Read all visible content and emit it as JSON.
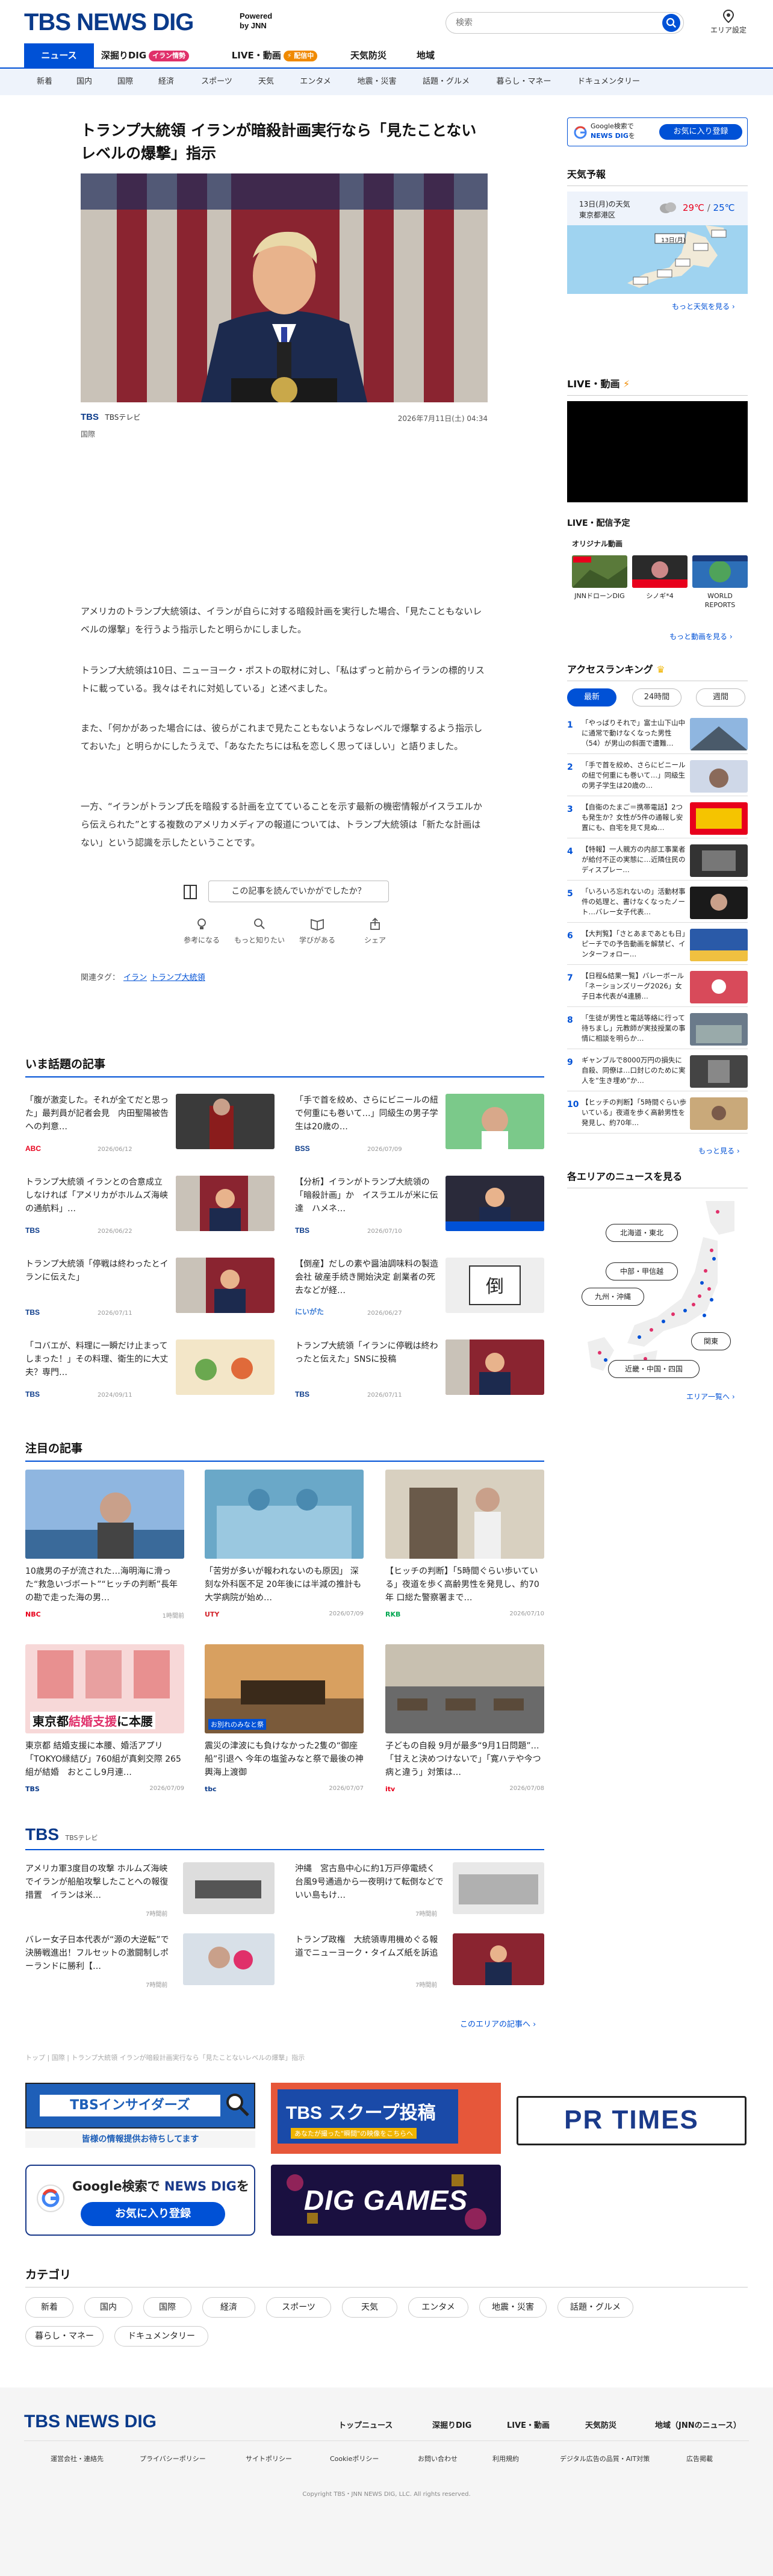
{
  "header": {
    "logo_text": "TBS NEWS DIG",
    "powered_line1": "Powered",
    "powered_line2": "by JNN",
    "search_placeholder": "検索",
    "area_label": "エリア設定",
    "nav": [
      {
        "label": "ニュース",
        "active": true
      },
      {
        "label": "深掘りDIG",
        "badge": "イラン情勢",
        "badge_color": "#e0306a"
      },
      {
        "label": "LIVE・動画",
        "badge": "⚡ 配信中",
        "badge_color": "#f08a00"
      },
      {
        "label": "天気防災"
      },
      {
        "label": "地域"
      }
    ],
    "subnav": [
      "新着",
      "国内",
      "国際",
      "経済",
      "スポーツ",
      "天気",
      "エンタメ",
      "地震・災害",
      "話題・グルメ",
      "暮らし・マネー",
      "ドキュメンタリー"
    ]
  },
  "article": {
    "title": "トランプ大統領 イランが暗殺計画実行なら「見たことないレベルの爆撃」指示",
    "source_logo": "TBS",
    "source_name": "TBSテレビ",
    "datetime": "2026年7月11日(土) 04:34",
    "category": "国際",
    "paragraphs": [
      "アメリカのトランプ大統領は、イランが自らに対する暗殺計画を実行した場合、「見たこともないレベルの爆撃」を行うよう指示したと明らかにしました。",
      "トランプ大統領は10日、ニューヨーク・ポストの取材に対し、「私はずっと前からイランの標的リストに載っている。我々はそれに対処している」と述べました。",
      "また、「何かがあった場合には、彼らがこれまで見たこともないようなレベルで爆撃するよう指示しておいた」と明らかにしたうえで、「あなたたちには私を恋しく思ってほしい」と語りました。",
      "一方、“イランがトランプ氏を暗殺する計画を立てていることを示す最新の機密情報がイスラエルから伝えられた”とする複数のアメリカメディアの報道については、トランプ大統領は「新たな計画はない」という認識を示したということです。"
    ],
    "feedback_button": "この記事を読んでいかがでしたか？",
    "reactions": [
      "参考になる",
      "もっと知りたい",
      "学びがある",
      "シェア"
    ],
    "tags_label": "関連タグ：",
    "tags": [
      "イラン",
      "トランプ大統領"
    ]
  },
  "sidebar": {
    "gsearch_line1": "Google検索で",
    "gsearch_line2": "NEWS DIG",
    "gsearch_line3": "を",
    "gsearch_button": "お気に入り登録",
    "weather_title": "天気予報",
    "weather_date": "13日(月)の天気",
    "weather_city": "東京都港区",
    "weather_high": "29℃",
    "weather_low": "25℃",
    "weather_map_date": "13日(月)",
    "weather_more": "もっと天気を見る",
    "live_title": "LIVE・動画",
    "live_schedule": "LIVE・配信予定",
    "original_video": "オリジナル動画",
    "live_items": [
      "JNNドローンDIG",
      "シノギ*4",
      "WORLD REPORTS"
    ],
    "live_more": "もっと動画を見る",
    "ranking_title": "アクセスランキング",
    "ranking_tabs": [
      "最新",
      "24時間",
      "週間"
    ],
    "ranking": [
      {
        "num": "1",
        "text": "「やっばりそれで」富士山下山中に通常で動けなくなった男性（54）が男山の斜面で遭難…"
      },
      {
        "num": "2",
        "text": "「手で首を絞め、さらにビニールの紐で何重にも巻いて…」同級生の男子学生は20歳の…"
      },
      {
        "num": "3",
        "text": "【自衛のたまご＝携帯電話】2つも発生か？女性が5件の通報し安置にも、自宅を見て見ぬ…"
      },
      {
        "num": "4",
        "text": "【特報】一人親方の内部工事業者が給付不正の実態に…近隣住民のディスプレー…"
      },
      {
        "num": "5",
        "text": "「いろいろ忘れないの」活動材事件の処理と、書けなくなったノート…バレー女子代表…"
      },
      {
        "num": "6",
        "text": "【大判覧】「さとあまであとも日」ピーチでの予告動画を解禁ビ、インターフォロー…"
      },
      {
        "num": "7",
        "text": "【日程&結果一覧】バレーボール「ネーションズリーグ2026」女子日本代表が4連勝…"
      },
      {
        "num": "8",
        "text": "「生徒が男性と電話等絡に行って待ちまし」元教師が実技授業の事情に相談を明らか…"
      },
      {
        "num": "9",
        "text": "ギャンブルで8000万円の損失に自殺、同僚は…口封じのために実人を“生き埋め”か…"
      },
      {
        "num": "10",
        "text": "【ヒッチの判断】「5時間ぐらい歩いている」夜道を歩く高齢男性を発見し、約70年…"
      }
    ],
    "ranking_more": "もっと見る",
    "area_title": "各エリアのニュースを見る",
    "areas": [
      "北海道・東北",
      "中部・甲信越",
      "九州・沖縄",
      "関東",
      "近畿・中国・四国"
    ],
    "area_more": "エリア一覧へ"
  },
  "trending": {
    "title": "いま話題の記事",
    "items": [
      {
        "text": "「腹が激変した。それが全てだと思った」最判員が記者会見　内田聖陽被告への判意…",
        "src": "ABC",
        "src_color": "#e8001c",
        "date": "2026/06/12"
      },
      {
        "text": "「手で首を絞め、さらにビニールの紐で何重にも巻いて…」同級生の男子学生は20歳の…",
        "src": "BSS",
        "src_color": "#0a3a8a",
        "date": "2026/07/09"
      },
      {
        "text": "トランプ大統領 イランとの合意成立しなければ「アメリカがホルムズ海峡の通航料」…",
        "src": "TBS",
        "src_color": "#0a3a8a",
        "date": "2026/06/22"
      },
      {
        "text": "【分析】イランがトランプ大統領の「暗殺計画」か　イスラエルが米に伝達　ハメネ…",
        "src": "TBS",
        "src_color": "#0a3a8a",
        "date": "2026/07/10"
      },
      {
        "text": "トランプ大統領「停戦は終わったとイランに伝えた」",
        "src": "TBS",
        "src_color": "#0a3a8a",
        "date": "2026/07/11"
      },
      {
        "text": "【倒産】だしの素や醤油調味料の製造会社 破産手続き開始決定 創業者の死去などが経…",
        "src": "にいがた",
        "src_color": "#3a7bd5",
        "date": "2026/06/27"
      },
      {
        "text": "「コバエが、料理に一瞬だけ止まってしまった！」その料理、衛生的に大丈夫？専門…",
        "src": "TBS",
        "src_color": "#0a3a8a",
        "date": "2024/09/11"
      },
      {
        "text": "トランプ大統領「イランに停戦は終わったと伝えた」SNSに投稿",
        "src": "TBS",
        "src_color": "#0a3a8a",
        "date": "2026/07/11"
      }
    ]
  },
  "featured": {
    "title": "注目の記事",
    "items": [
      {
        "text": "10歳男の子が流された…海明海に滑った“救急いづボート”“ヒッチの判断”長年の勘で走った海の男…",
        "src": "NBC",
        "src_color": "#e8001c",
        "date": "1時間前"
      },
      {
        "text": "「苦労が多いが報われないのも原因」 深刻な外科医不足 20年後には半減の推計も 大学病院が始め…",
        "src": "UTY",
        "src_color": "#d2232a",
        "date": "2026/07/09"
      },
      {
        "text": "【ヒッチの判断】「5時間ぐらい歩いている」夜道を歩く高齢男性を発見し、約70年 口総た警察署まで…",
        "src": "RKB",
        "src_color": "#00a650",
        "date": "2026/07/10"
      },
      {
        "text": "東京都 結婚支援に本腰、婚活アプリ「TOKYO縁結び」760組が真剣交際 265組が結婚　おとこし9月連…",
        "src": "TBS",
        "src_color": "#0a3a8a",
        "date": "2026/07/09",
        "overlay1": "東京都",
        "overlay2": "結婚支援",
        "overlay3": "に本腰"
      },
      {
        "text": "震災の津波にも負けなかった2隻の“御座船”引退へ 今年の塩釜みなと祭で最後の神輿海上渡御",
        "src": "tbc",
        "src_color": "#0a3a8a",
        "date": "2026/07/07",
        "overlay1": "お別れのみなと祭"
      },
      {
        "text": "子どもの自殺 9月が最多“9月1日問題”…「甘えと決めつけないで」「寛ハテや今つ病と違う」対策は…",
        "src": "itv",
        "src_color": "#e8001c",
        "date": "2026/07/08"
      }
    ]
  },
  "tbs_block": {
    "logo": "TBS",
    "sub": "TBSテレビ",
    "items": [
      {
        "text": "アメリカ軍3度目の攻撃 ホルムズ海峡でイランが船舶攻撃したことへの報復措置　イランは米…",
        "date": "7時間前"
      },
      {
        "text": "沖縄　宮古島中心に約1万戸停電続く　台風9号通過から一夜明けて転倒などでいい島もけ…",
        "date": "7時間前"
      },
      {
        "text": "バレー女子日本代表が“源の大逆転”で決勝戦進出！フルセットの激闘制しポーランドに勝利【…",
        "date": "7時間前"
      },
      {
        "text": "トランプ政権　大統領専用機めぐる報道でニューヨーク・タイムズ紙を訴追",
        "date": "7時間前"
      }
    ],
    "more": "このエリアの記事へ"
  },
  "breadcrumb": "トップ | 国際 | トランプ大統領 イランが暗殺計画実行なら「見たことないレベルの爆撃」指示",
  "banners": {
    "insider": "TBSインサイダーズ",
    "insider_sub": "皆様の情報提供お待ちしてます",
    "scoop_logo": "TBS",
    "scoop": "スクープ投稿",
    "scoop_sub": "あなたが撮った\"瞬間\"の映像をこちらへ",
    "prtimes": "PR TIMES",
    "gsearch_line1": "Google検索で",
    "gsearch_brand": "NEWS DIG",
    "gsearch_line2": "を",
    "gsearch_button": "お気に入り登録",
    "games": "DIG GAMES"
  },
  "categories": {
    "title": "カテゴリ",
    "items": [
      "新着",
      "国内",
      "国際",
      "経済",
      "スポーツ",
      "天気",
      "エンタメ",
      "地震・災害",
      "話題・グルメ",
      "暮らし・マネー",
      "ドキュメンタリー"
    ]
  },
  "footer": {
    "logo": "TBS NEWS DIG",
    "nav": [
      "トップニュース",
      "深掘りDIG",
      "LIVE・動画",
      "天気防災",
      "地域（JNNのニュース）"
    ],
    "links": [
      "運営会社・連絡先",
      "プライバシーポリシー",
      "サイトポリシー",
      "Cookieポリシー",
      "お問い合わせ",
      "利用規約",
      "デジタル広告の品質・AIT対策",
      "広告掲載"
    ],
    "copyright": "Copyright TBS・JNN NEWS DIG, LLC. All rights reserved."
  },
  "colors": {
    "brand": "#0a3a8a",
    "accent": "#0051d6",
    "pink": "#e0306a",
    "orange": "#f08a00"
  }
}
